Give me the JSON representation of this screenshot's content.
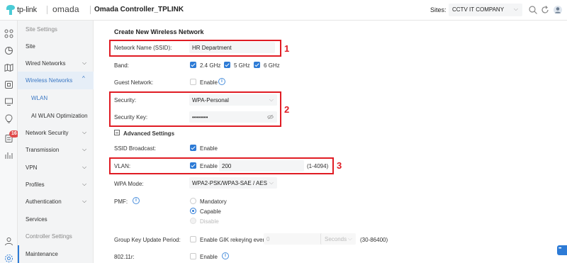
{
  "header": {
    "brand_tplink": "tp-link",
    "brand_omada": "omada",
    "app_title": "Omada Controller_TPLINK",
    "sites_label": "Sites:",
    "sites_value": "CCTV IT COMPANY"
  },
  "rail": {
    "alerts_badge": "16"
  },
  "sidebar": {
    "items": [
      {
        "label": "Site Settings"
      },
      {
        "label": "Site"
      },
      {
        "label": "Wired Networks"
      },
      {
        "label": "Wireless Networks"
      },
      {
        "label": "WLAN"
      },
      {
        "label": "AI WLAN Optimization"
      },
      {
        "label": "Network Security"
      },
      {
        "label": "Transmission"
      },
      {
        "label": "VPN"
      },
      {
        "label": "Profiles"
      },
      {
        "label": "Authentication"
      },
      {
        "label": "Services"
      },
      {
        "label": "Controller Settings"
      },
      {
        "label": "Maintenance"
      }
    ]
  },
  "form": {
    "title": "Create New Wireless Network",
    "ssid_label": "Network Name (SSID):",
    "ssid_value": "HR Department",
    "band_label": "Band:",
    "band_24": "2.4 GHz",
    "band_5": "5 GHz",
    "band_6": "6 GHz",
    "guest_label": "Guest Network:",
    "enable": "Enable",
    "security_label": "Security:",
    "security_value": "WPA-Personal",
    "key_label": "Security Key:",
    "key_value": "••••••••",
    "advanced_label": "Advanced Settings",
    "ssid_broadcast_label": "SSID Broadcast:",
    "vlan_label": "VLAN:",
    "vlan_value": "200",
    "vlan_range": "(1-4094)",
    "wpa_mode_label": "WPA Mode:",
    "wpa_mode_value": "WPA2-PSK/WPA3-SAE / AES",
    "pmf_label": "PMF:",
    "pmf_mandatory": "Mandatory",
    "pmf_capable": "Capable",
    "pmf_disable": "Disable",
    "gk_label": "Group Key Update Period:",
    "gk_enable": "Enable GIK rekeying every",
    "gk_value": "0",
    "gk_unit": "Seconds",
    "gk_range": "(30-86400)",
    "r80211_label": "802.11r:"
  },
  "annotations": {
    "n1": "1",
    "n2": "2",
    "n3": "3"
  },
  "colors": {
    "accent": "#2d7bd6",
    "annotation": "#e01c24",
    "brand": "#4acbd6"
  }
}
